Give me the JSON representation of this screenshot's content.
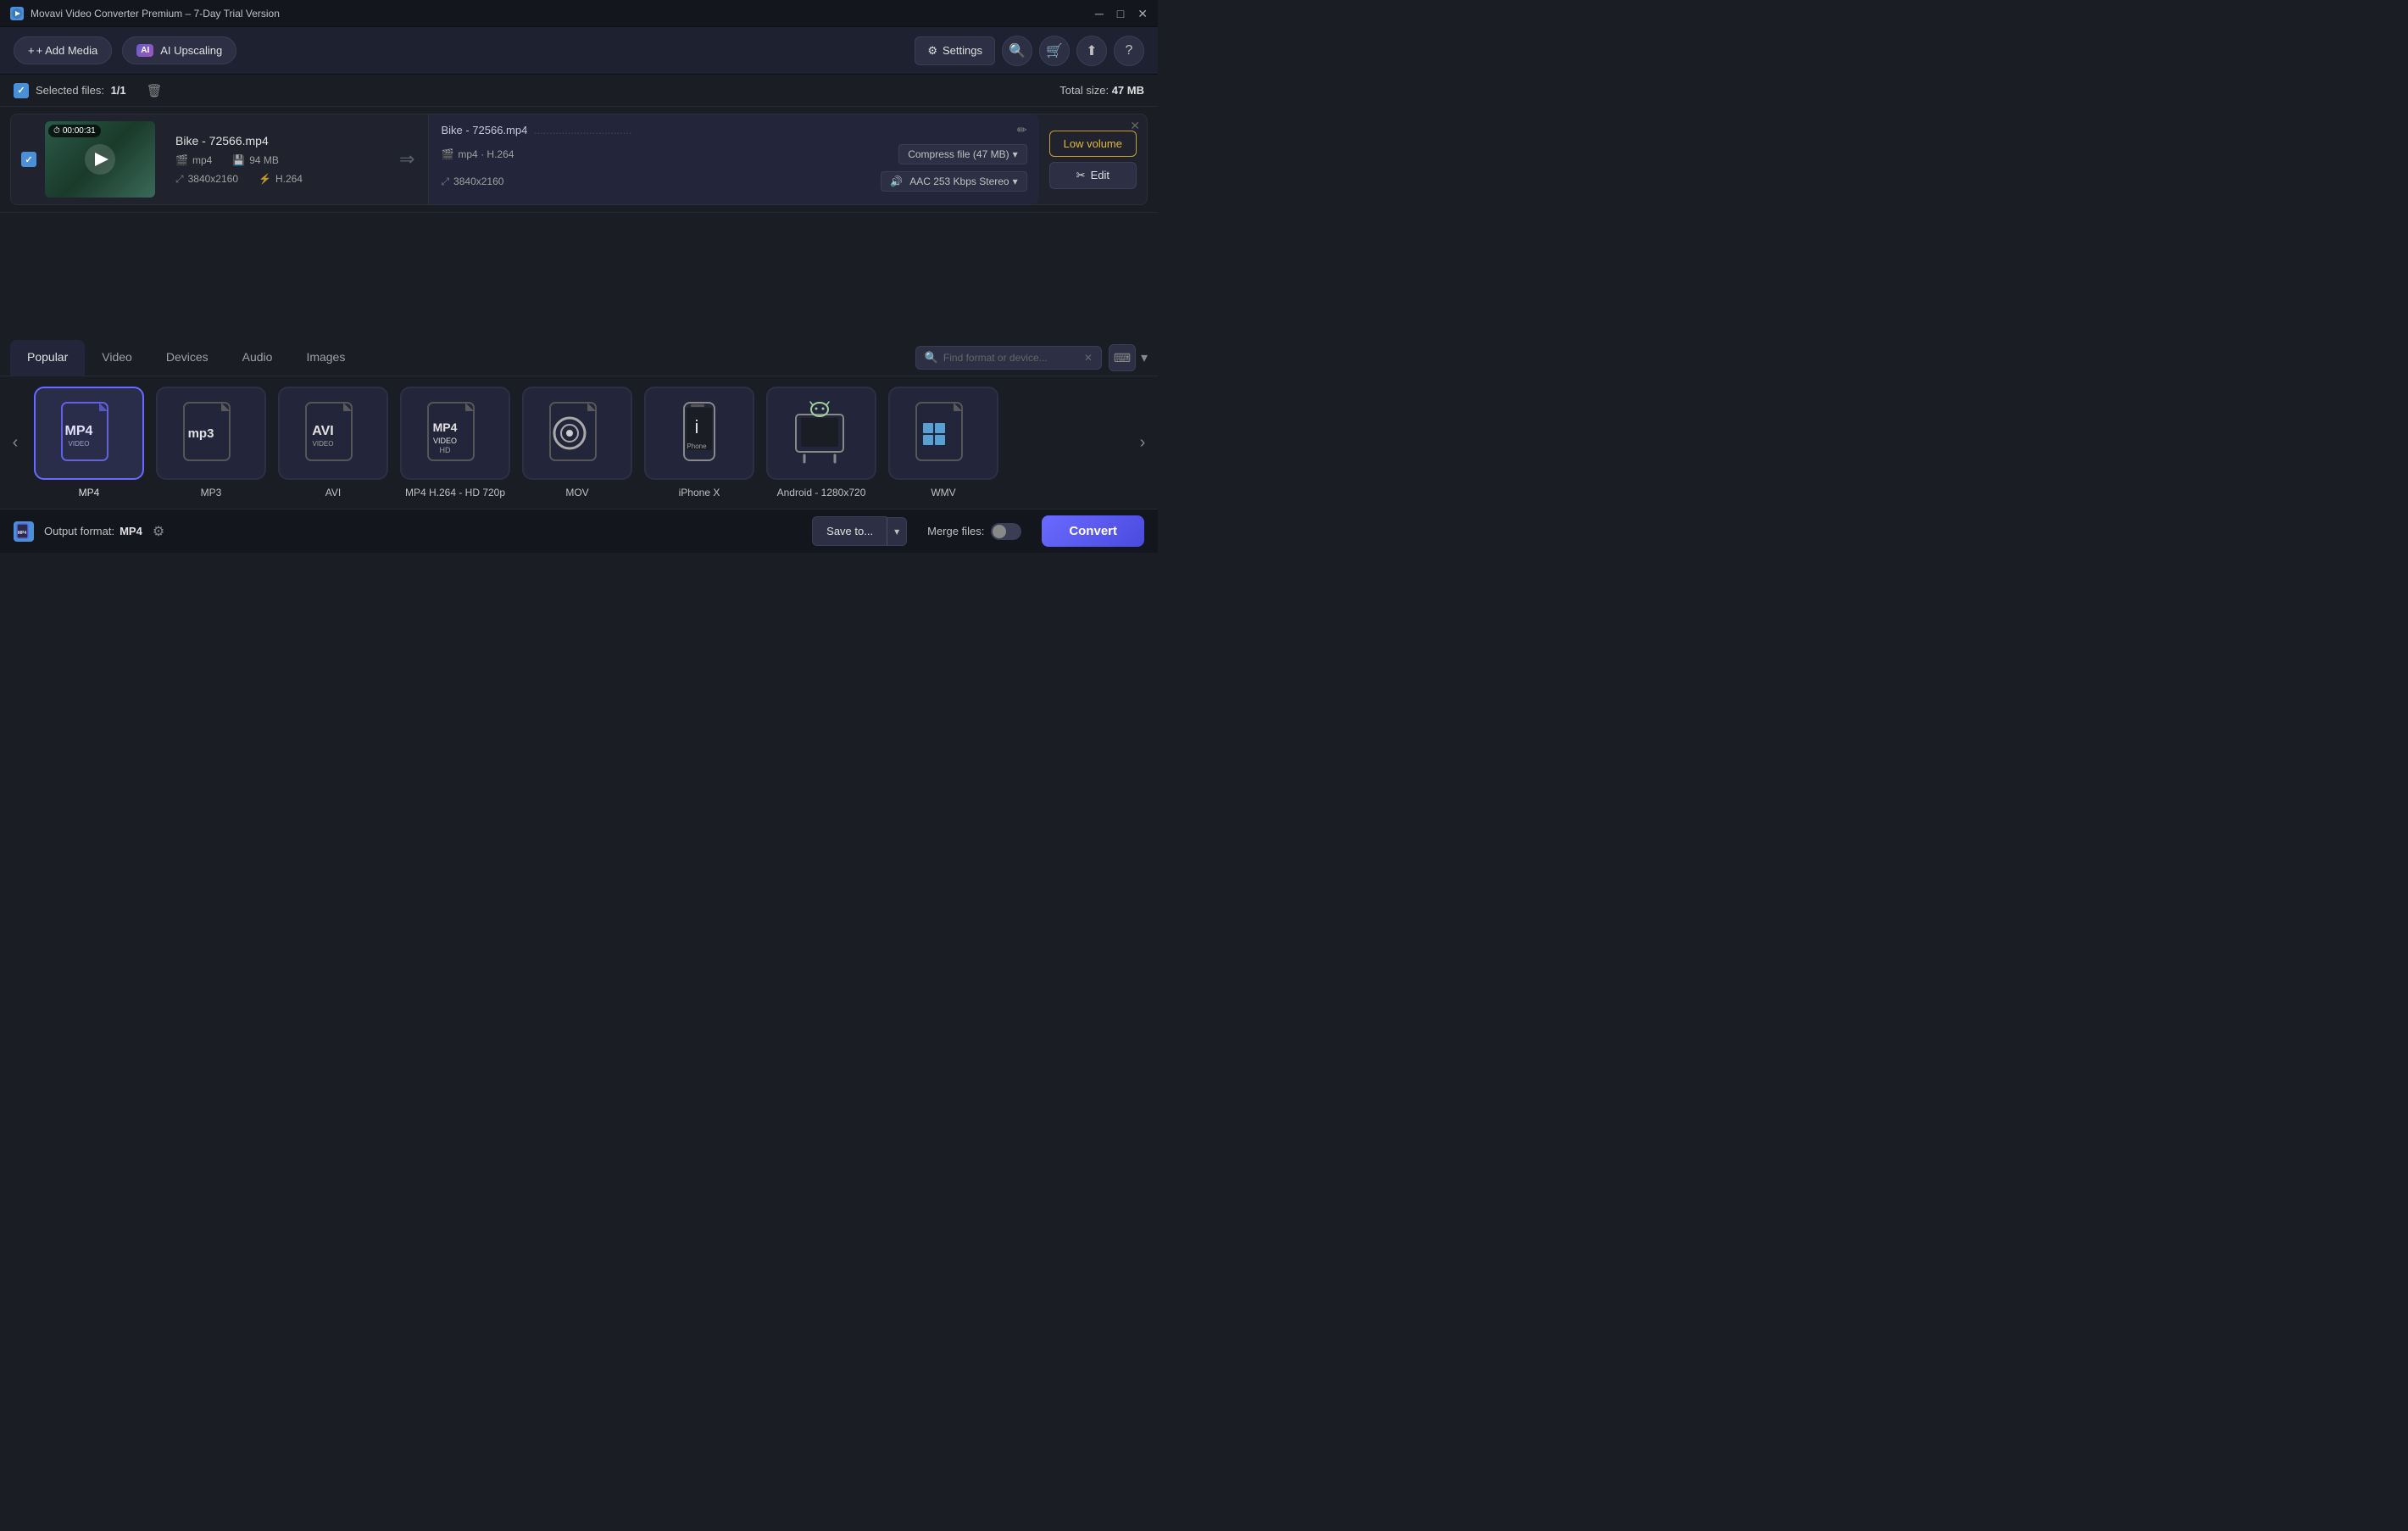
{
  "titlebar": {
    "title": "Movavi Video Converter Premium – 7-Day Trial Version",
    "icon": "M",
    "minimize": "─",
    "maximize": "□",
    "close": "✕"
  },
  "toolbar": {
    "add_media_label": "+ Add Media",
    "ai_upscaling_label": "AI Upscaling",
    "settings_label": "⚙ Settings",
    "search_icon": "🔍",
    "cart_icon": "🛒",
    "share_icon": "⬆",
    "help_icon": "?"
  },
  "file_info": {
    "selected_label": "Selected files:",
    "selected_count": "1/1",
    "total_size_label": "Total size:",
    "total_size_value": "47 MB"
  },
  "file_item": {
    "timestamp": "00:00:31",
    "filename": "Bike - 72566.mp4",
    "format": "mp4",
    "size": "94 MB",
    "resolution": "3840x2160",
    "codec": "H.264",
    "output_filename": "Bike - 72566.mp4",
    "output_format": "mp4 · H.264",
    "output_resolution": "3840x2160",
    "compress_label": "Compress file (47 MB)",
    "audio_label": "AAC 253 Kbps Stereo",
    "low_volume_label": "Low volume",
    "edit_label": "✂ Edit"
  },
  "format_area": {
    "tabs": [
      {
        "id": "popular",
        "label": "Popular",
        "active": true
      },
      {
        "id": "video",
        "label": "Video",
        "active": false
      },
      {
        "id": "devices",
        "label": "Devices",
        "active": false
      },
      {
        "id": "audio",
        "label": "Audio",
        "active": false
      },
      {
        "id": "images",
        "label": "Images",
        "active": false
      }
    ],
    "search_placeholder": "Find format or device...",
    "formats": [
      {
        "id": "mp4",
        "label": "MP4",
        "sub": "VIDEO",
        "selected": true,
        "color": "#6060e0"
      },
      {
        "id": "mp3",
        "label": "MP3",
        "sub": "",
        "selected": false,
        "color": "#e0e0e0"
      },
      {
        "id": "avi",
        "label": "AVI",
        "sub": "VIDEO",
        "selected": false,
        "color": "#e0e0e0"
      },
      {
        "id": "mp4hd",
        "label": "MP4 H.264 - HD 720p",
        "sub": "VIDEO HD",
        "selected": false,
        "color": "#e0e0e0"
      },
      {
        "id": "mov",
        "label": "MOV",
        "sub": "",
        "selected": false,
        "color": "#e0e0e0"
      },
      {
        "id": "iphonex",
        "label": "iPhone X",
        "sub": "",
        "selected": false,
        "color": "#e0e0e0"
      },
      {
        "id": "android",
        "label": "Android - 1280x720",
        "sub": "",
        "selected": false,
        "color": "#e0e0e0"
      },
      {
        "id": "wmv",
        "label": "WMV",
        "sub": "",
        "selected": false,
        "color": "#e0e0e0"
      }
    ]
  },
  "bottom_bar": {
    "output_format_label": "Output format:",
    "output_format_value": "MP4",
    "save_to_label": "Save to...",
    "merge_label": "Merge files:",
    "convert_label": "Convert"
  }
}
